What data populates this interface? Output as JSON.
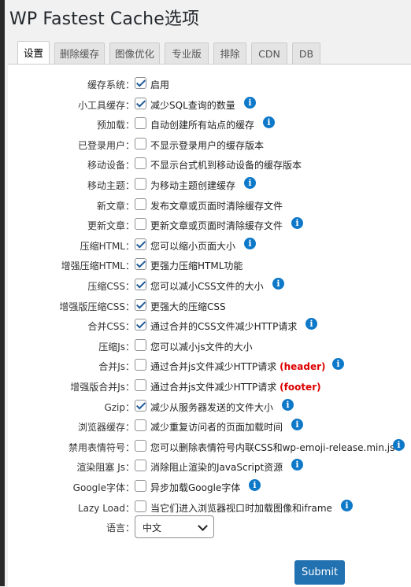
{
  "page_title": "WP Fastest Cache选项",
  "tabs": [
    "设置",
    "删除缓存",
    "图像优化",
    "专业版",
    "排除",
    "CDN",
    "DB"
  ],
  "settings": [
    {
      "label": "缓存系统：",
      "checked": true,
      "desc": "启用",
      "info": false
    },
    {
      "label": "小工具缓存：",
      "checked": true,
      "desc": "减少SQL查询的数量",
      "info": true
    },
    {
      "label": "预加载：",
      "checked": false,
      "desc": "自动创建所有站点的缓存",
      "info": true
    },
    {
      "label": "已登录用户：",
      "checked": false,
      "desc": "不显示登录用户的缓存版本",
      "info": false
    },
    {
      "label": "移动设备：",
      "checked": false,
      "desc": "不显示台式机到移动设备的缓存版本",
      "info": false
    },
    {
      "label": "移动主题：",
      "checked": false,
      "desc": "为移动主题创建缓存",
      "info": true
    },
    {
      "label": "新文章：",
      "checked": false,
      "desc": "发布文章或页面时清除缓存文件",
      "info": false
    },
    {
      "label": "更新文章：",
      "checked": false,
      "desc": "更新文章或页面时清除缓存文件",
      "info": true
    },
    {
      "label": "压缩HTML：",
      "checked": true,
      "desc": "您可以缩小页面大小",
      "info": true
    },
    {
      "label": "增强压缩HTML：",
      "checked": true,
      "desc": "更强力压缩HTML功能",
      "info": false
    },
    {
      "label": "压缩CSS：",
      "checked": true,
      "desc": "您可以减小CSS文件的大小",
      "info": true
    },
    {
      "label": "增强版压缩CSS：",
      "checked": true,
      "desc": "更强大的压缩CSS",
      "info": false
    },
    {
      "label": "合并CSS：",
      "checked": true,
      "desc": "通过合并的CSS文件减少HTTP请求",
      "info": true
    },
    {
      "label": "压缩Js：",
      "checked": false,
      "desc": "您可以减小js文件的大小",
      "info": false
    },
    {
      "label": "合并Js：",
      "checked": false,
      "desc": "通过合并js文件减少HTTP请求",
      "tag": "(header)",
      "info": true
    },
    {
      "label": "增强版合并Js：",
      "checked": false,
      "desc": "通过合并js文件减少HTTP请求",
      "tag": "(footer)",
      "info": false
    },
    {
      "label": "Gzip：",
      "checked": true,
      "desc": "减少从服务器发送的文件大小",
      "info": true
    },
    {
      "label": "浏览器缓存：",
      "checked": false,
      "desc": "减少重复访问者的页面加载时间",
      "info": true
    },
    {
      "label": "禁用表情符号：",
      "checked": false,
      "desc": "您可以删除表情符号内联CSS和wp-emoji-release.min.js",
      "info": true
    },
    {
      "label": "渲染阻塞 Js：",
      "checked": false,
      "desc": "消除阻止渲染的JavaScript资源",
      "info": true
    },
    {
      "label": "Google字体：",
      "checked": false,
      "desc": "异步加载Google字体",
      "info": true
    },
    {
      "label": "Lazy Load：",
      "checked": false,
      "desc": "当它们进入浏览器视口时加载图像和iframe",
      "info": true
    }
  ],
  "language": {
    "label": "语言：",
    "value": "中文"
  },
  "submit_label": "Submit",
  "info_glyph": "i",
  "colors": {
    "accent": "#2271b1",
    "info": "#0e78c9",
    "tag": "#dd0000"
  }
}
